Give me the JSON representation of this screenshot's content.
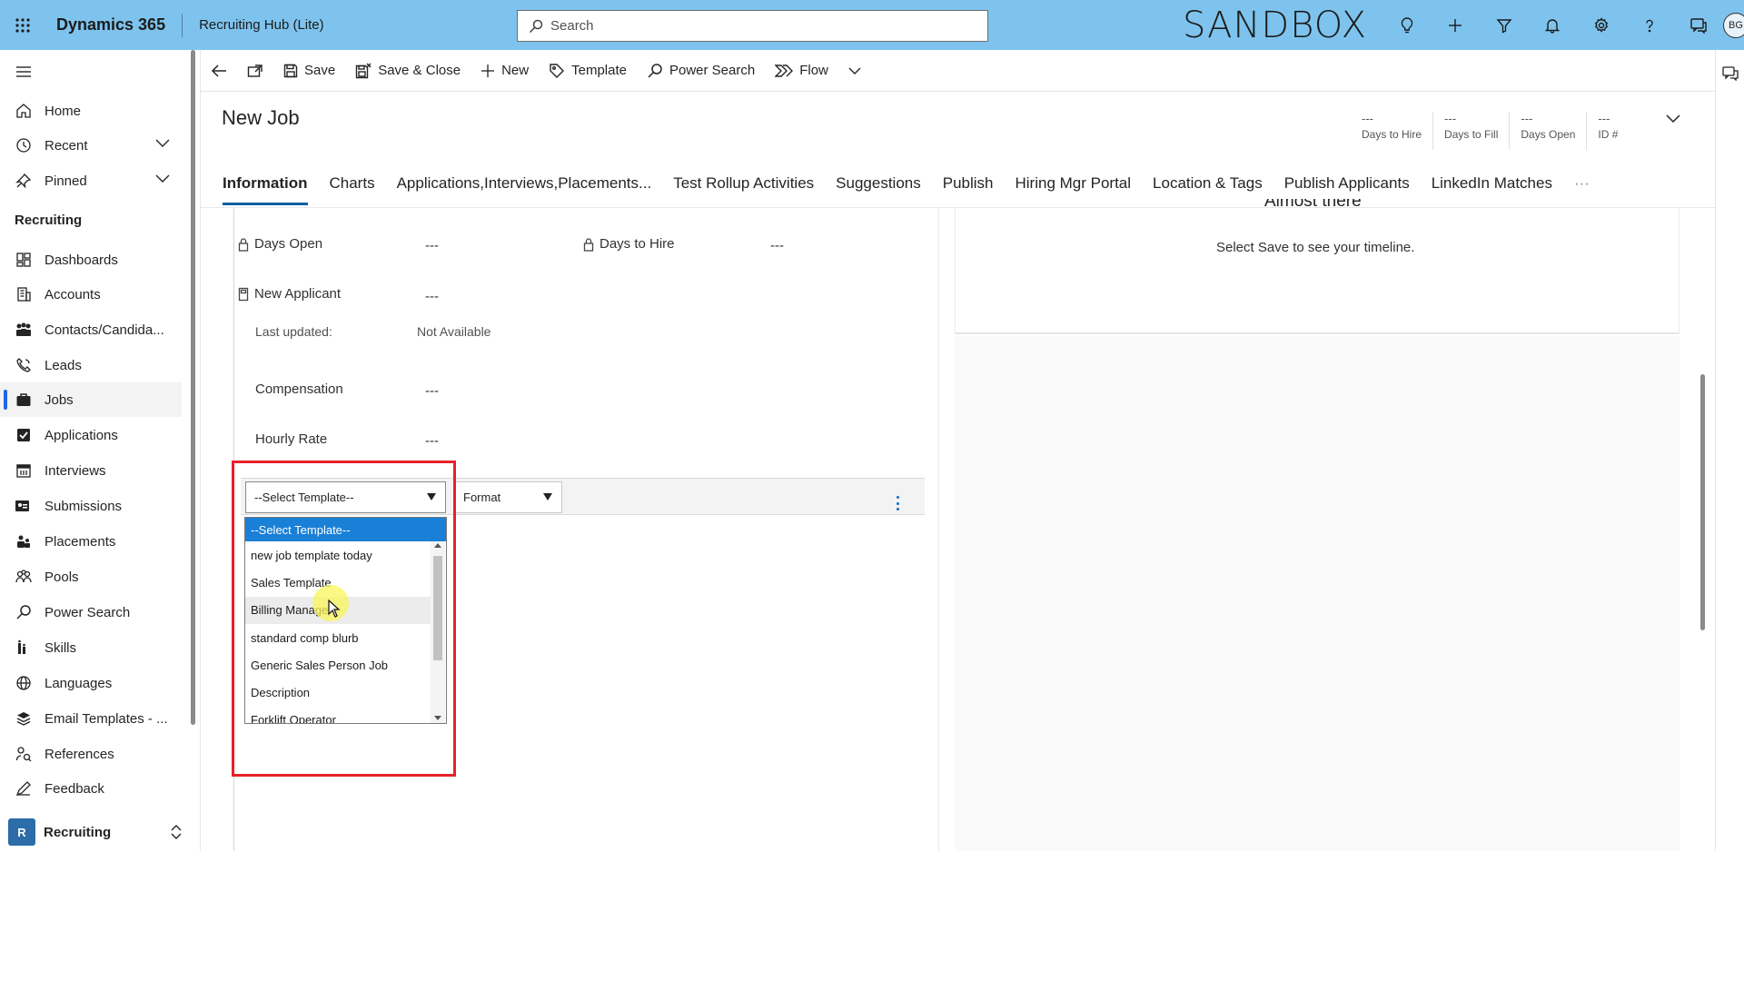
{
  "topbar": {
    "app_name": "Dynamics 365",
    "area_name": "Recruiting Hub (Lite)",
    "search_placeholder": "Search",
    "environment_label": "SANDBOX",
    "user_initials": "BG",
    "icons": [
      "lightbulb-icon",
      "plus-icon",
      "filter-icon",
      "bell-icon",
      "gear-icon",
      "help-icon",
      "chat-icon"
    ]
  },
  "sidebar": {
    "top_items": [
      {
        "label": "Home",
        "icon": "home-icon"
      },
      {
        "label": "Recent",
        "icon": "clock-icon"
      },
      {
        "label": "Pinned",
        "icon": "pin-icon"
      }
    ],
    "section_title": "Recruiting",
    "items": [
      {
        "label": "Dashboards",
        "icon": "dashboard-icon"
      },
      {
        "label": "Accounts",
        "icon": "accounts-icon"
      },
      {
        "label": "Contacts/Candida...",
        "icon": "contacts-icon"
      },
      {
        "label": "Leads",
        "icon": "leads-icon"
      },
      {
        "label": "Jobs",
        "icon": "briefcase-icon",
        "active": true
      },
      {
        "label": "Applications",
        "icon": "checkbox-icon"
      },
      {
        "label": "Interviews",
        "icon": "calendar-icon"
      },
      {
        "label": "Submissions",
        "icon": "submissions-icon"
      },
      {
        "label": "Placements",
        "icon": "placements-icon"
      },
      {
        "label": "Pools",
        "icon": "people-icon"
      },
      {
        "label": "Power Search",
        "icon": "search-icon"
      },
      {
        "label": "Skills",
        "icon": "skills-icon"
      },
      {
        "label": "Languages",
        "icon": "globe-icon"
      },
      {
        "label": "Email Templates - ...",
        "icon": "layers-icon"
      },
      {
        "label": "References",
        "icon": "references-icon"
      },
      {
        "label": "Feedback",
        "icon": "feedback-icon"
      }
    ],
    "area_switcher": {
      "badge": "R",
      "label": "Recruiting"
    }
  },
  "commandbar": {
    "back_label": "",
    "save_label": "Save",
    "save_close_label": "Save & Close",
    "new_label": "New",
    "template_label": "Template",
    "power_search_label": "Power Search",
    "flow_label": "Flow"
  },
  "header": {
    "title": "New Job",
    "fields": [
      {
        "value": "---",
        "label": "Days to Hire"
      },
      {
        "value": "---",
        "label": "Days to Fill"
      },
      {
        "value": "---",
        "label": "Days Open"
      },
      {
        "value": "---",
        "label": "ID #"
      }
    ]
  },
  "tabs": [
    "Information",
    "Charts",
    "Applications,Interviews,Placements...",
    "Test Rollup Activities",
    "Suggestions",
    "Publish",
    "Hiring Mgr Portal",
    "Location & Tags",
    "Publish Applicants",
    "LinkedIn Matches",
    "···"
  ],
  "form": {
    "days_open_label": "Days Open",
    "days_open_value": "---",
    "days_to_hire_label": "Days to Hire",
    "days_to_hire_value": "---",
    "new_applicant_label": "New Applicant",
    "new_applicant_value": "---",
    "last_updated_label": "Last updated:",
    "last_updated_value": "Not Available",
    "compensation_label": "Compensation",
    "compensation_value": "---",
    "hourly_rate_label": "Hourly Rate",
    "hourly_rate_value": "---"
  },
  "editor": {
    "template_select_value": "--Select Template--",
    "format_select_value": "Format",
    "template_options": [
      "--Select Template--",
      "new job template today",
      "Sales Template",
      "Billing Manager",
      "standard comp blurb",
      "Generic Sales Person Job",
      "Description",
      "Forklift Operator"
    ],
    "selected_index": 0,
    "hover_index": 3
  },
  "timeline": {
    "heading": "Almost there",
    "message": "Select Save to see your timeline."
  },
  "colors": {
    "topbar_bg": "#7ec3ed",
    "accent": "#115ea3",
    "active_nav": "#2266e3",
    "dropdown_selected": "#1a7fd6",
    "highlight_box": "#e8202a",
    "area_badge": "#2c6ca8"
  }
}
